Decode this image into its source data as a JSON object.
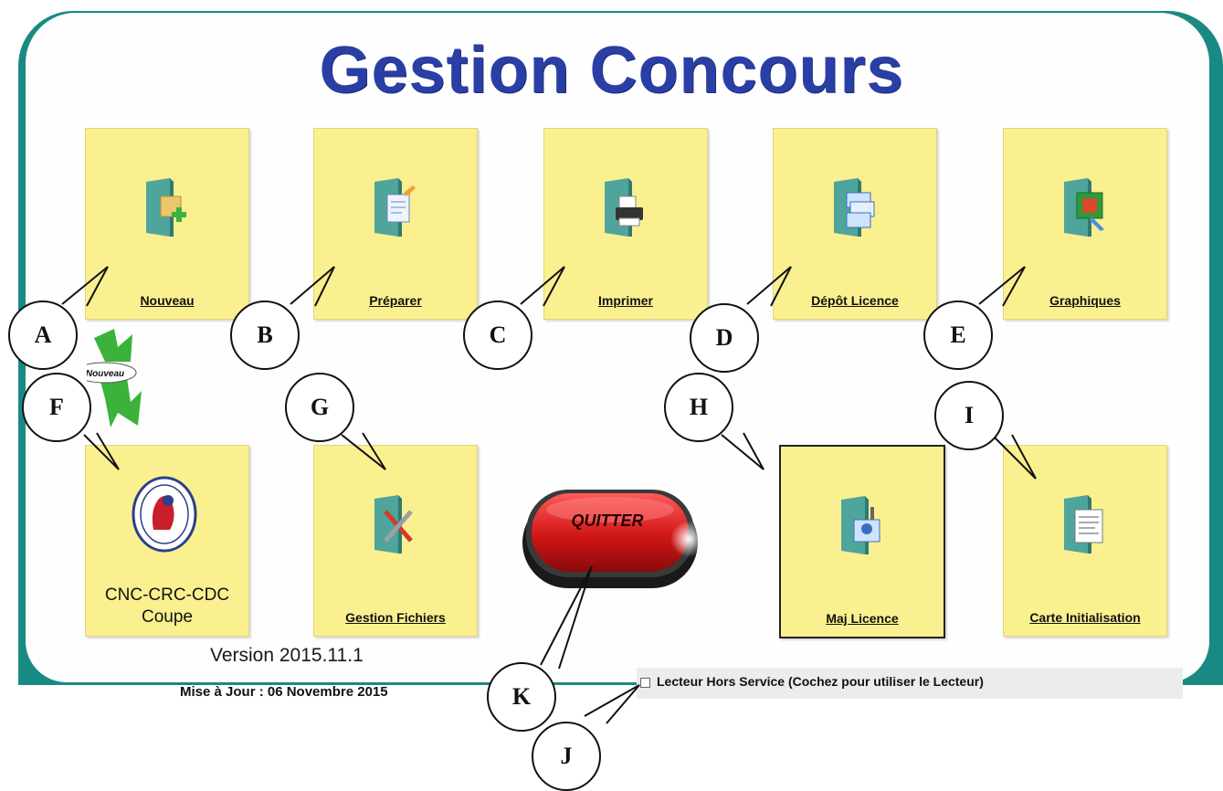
{
  "app": {
    "title": "Gestion Concours",
    "version": "Version 2015.11.1",
    "update_text": "Mise à Jour : 06 Novembre 2015"
  },
  "tiles": {
    "nouveau": "Nouveau",
    "preparer": "Préparer",
    "imprimer": "Imprimer",
    "depot_licence": "Dépôt Licence",
    "graphiques": "Graphiques",
    "cnc_line1": "CNC-CRC-CDC",
    "cnc_line2": "Coupe",
    "gestion_fichiers": "Gestion Fichiers",
    "maj_licence": "Maj Licence",
    "carte_initialisation": "Carte Initialisation"
  },
  "badge": {
    "new_label": "Nouveau"
  },
  "quit_button": {
    "label": "QUITTER"
  },
  "reader": {
    "label": "Lecteur Hors Service (Cochez pour utiliser le Lecteur)",
    "checked": false
  },
  "callouts": [
    "A",
    "B",
    "C",
    "D",
    "E",
    "F",
    "G",
    "H",
    "I",
    "J",
    "K"
  ],
  "colors": {
    "frame": "#198a83",
    "title": "#2a3fa5",
    "tile": "#faf08f",
    "quit": "#d01616"
  },
  "icons": {
    "nouveau": "folder-add-icon",
    "preparer": "folder-edit-icon",
    "imprimer": "folder-printer-icon",
    "depot_licence": "folder-cards-icon",
    "graphiques": "folder-chart-icon",
    "cnc": "federation-logo-icon",
    "gestion_fichiers": "folder-tools-icon",
    "maj_licence": "folder-id-card-icon",
    "carte_initialisation": "folder-document-icon"
  }
}
